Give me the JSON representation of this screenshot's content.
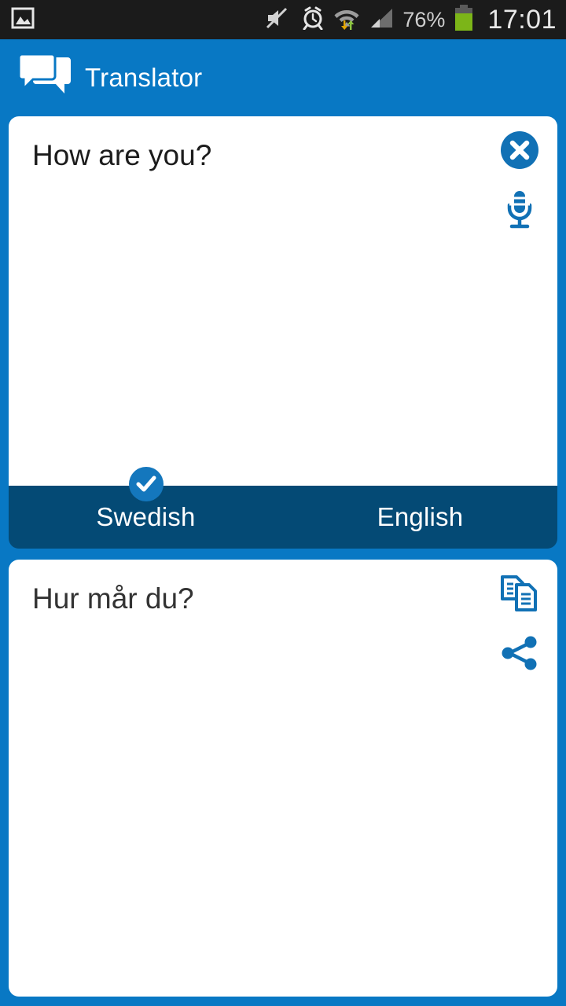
{
  "statusbar": {
    "time": "17:01",
    "battery_percent": "76%",
    "icons": [
      "photo-icon",
      "sound-muted-icon",
      "alarm-clock-icon",
      "wifi-data-transfer-icon",
      "cellular-signal-icon",
      "battery-icon"
    ],
    "battery_color": "#7cb518",
    "background": "#1b1b1b"
  },
  "appbar": {
    "title": "Translator",
    "icon": "chat-bubbles-icon",
    "background": "#0878c4"
  },
  "source_card": {
    "text": "How are you?",
    "clear_icon": "clear-circle-icon",
    "mic_icon": "microphone-icon"
  },
  "language_bar": {
    "source_language": "Swedish",
    "target_language": "English",
    "selected": "Swedish",
    "check_icon": "check-circle-icon",
    "background": "#044a75",
    "check_color": "#1477bd"
  },
  "target_card": {
    "text": "Hur mår du?",
    "copy_icon": "copy-icon",
    "share_icon": "share-icon"
  },
  "colors": {
    "accent": "#0878c4",
    "dark_accent": "#044a75",
    "icon_blue": "#1171b5"
  }
}
